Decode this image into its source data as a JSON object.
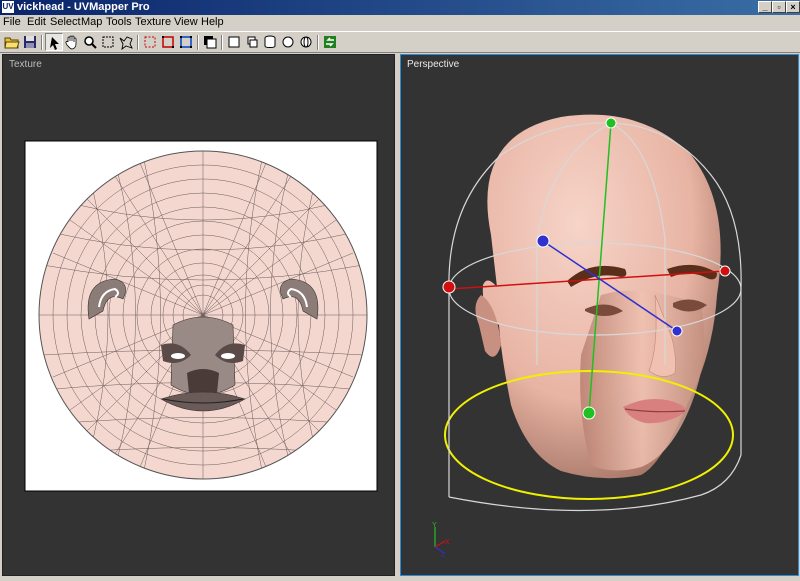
{
  "window": {
    "icon_text": "UV",
    "title": "vickhead - UVMapper Pro"
  },
  "window_buttons": [
    "_",
    "▫",
    "×"
  ],
  "menu": [
    {
      "label": "File"
    },
    {
      "label": "Edit"
    },
    {
      "label": "Select"
    },
    {
      "label": "Map"
    },
    {
      "label": "Tools"
    },
    {
      "label": "Texture"
    },
    {
      "label": "View"
    },
    {
      "label": "Help"
    }
  ],
  "toolbar": {
    "buttons": [
      {
        "name": "open-folder-icon"
      },
      {
        "name": "save-disk-icon"
      },
      {
        "name": "select-arrow-icon",
        "pressed": true
      },
      {
        "name": "pan-hand-icon"
      },
      {
        "name": "zoom-magnifier-icon"
      },
      {
        "name": "marquee-select-icon"
      },
      {
        "name": "lasso-select-icon"
      },
      {
        "name": "select-vertices-icon"
      },
      {
        "name": "select-edges-icon"
      },
      {
        "name": "select-faces-icon"
      },
      {
        "name": "copy-window-icon"
      },
      {
        "name": "box-map-icon"
      },
      {
        "name": "cylinder-map-icon"
      },
      {
        "name": "cylinder-cap-map-icon"
      },
      {
        "name": "sphere-map-icon"
      },
      {
        "name": "torus-map-icon"
      },
      {
        "name": "apply-mapping-icon"
      }
    ]
  },
  "texture_panel": {
    "label": "Texture",
    "background": "#333333"
  },
  "perspective_panel": {
    "label": "Perspective",
    "border_color": "#2a8cd6"
  },
  "axis_gizmo": {
    "y": "Y",
    "x": "X",
    "z": "Z"
  },
  "colors": {
    "skin": "#f0c8bc",
    "selected_border": "#2a8cd6",
    "titlebar": "#0a246a",
    "footprint_ring": "#f0f000"
  }
}
